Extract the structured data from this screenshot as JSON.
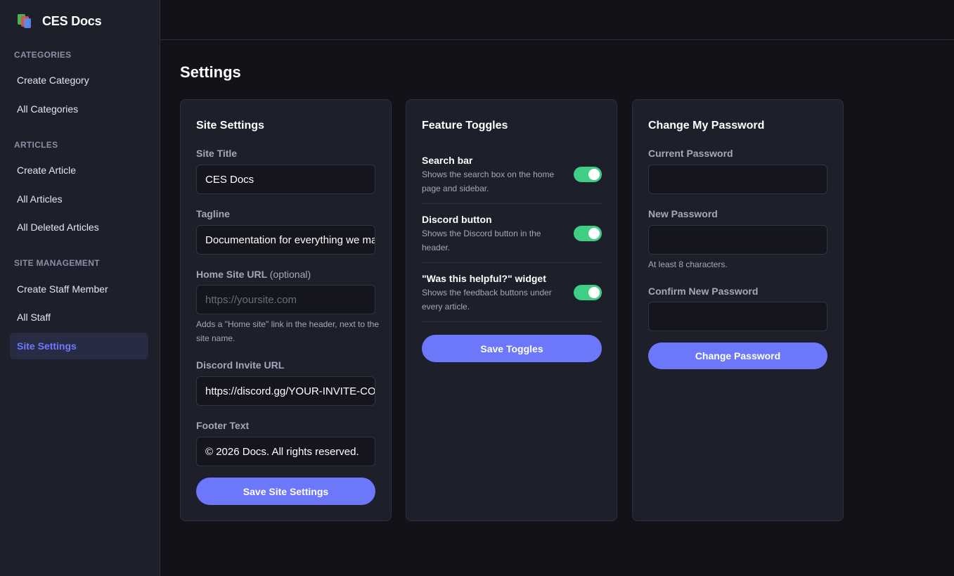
{
  "brand": {
    "name": "CES Docs",
    "logo_icon": "stacked-books-logo"
  },
  "sidebar": {
    "sections": [
      {
        "title": "CATEGORIES",
        "items": [
          {
            "label": "Create Category"
          },
          {
            "label": "All Categories"
          }
        ]
      },
      {
        "title": "ARTICLES",
        "items": [
          {
            "label": "Create Article"
          },
          {
            "label": "All Articles"
          },
          {
            "label": "All Deleted Articles"
          }
        ]
      },
      {
        "title": "SITE MANAGEMENT",
        "items": [
          {
            "label": "Create Staff Member"
          },
          {
            "label": "All Staff"
          },
          {
            "label": "Site Settings",
            "active": true
          }
        ]
      }
    ]
  },
  "page": {
    "title": "Settings"
  },
  "site_settings": {
    "title": "Site Settings",
    "site_title_label": "Site Title",
    "site_title_value": "CES Docs",
    "tagline_label": "Tagline",
    "tagline_value": "Documentation for everything we make",
    "home_url_label": "Home Site URL",
    "home_url_optional": "(optional)",
    "home_url_placeholder": "https://yoursite.com",
    "home_url_hint": "Adds a \"Home site\" link in the header, next to the site name.",
    "discord_label": "Discord Invite URL",
    "discord_value": "https://discord.gg/YOUR-INVITE-CODE",
    "footer_label": "Footer Text",
    "footer_value": "© 2026 Docs. All rights reserved.",
    "save_label": "Save Site Settings"
  },
  "feature_toggles": {
    "title": "Feature Toggles",
    "items": [
      {
        "name": "Search bar",
        "description": "Shows the search box on the home page and sidebar.",
        "enabled": true
      },
      {
        "name": "Discord button",
        "description": "Shows the Discord button in the header.",
        "enabled": true
      },
      {
        "name": "\"Was this helpful?\" widget",
        "description": "Shows the feedback buttons under every article.",
        "enabled": true
      }
    ],
    "save_label": "Save Toggles"
  },
  "change_password": {
    "title": "Change My Password",
    "current_label": "Current Password",
    "new_label": "New Password",
    "new_hint": "At least 8 characters.",
    "confirm_label": "Confirm New Password",
    "submit_label": "Change Password"
  },
  "colors": {
    "accent": "#6c77fa",
    "toggle_on": "#3ecf84",
    "active_nav": "#6c7aff",
    "sidebar_bg": "#1d1f2b",
    "page_bg": "#121218"
  }
}
